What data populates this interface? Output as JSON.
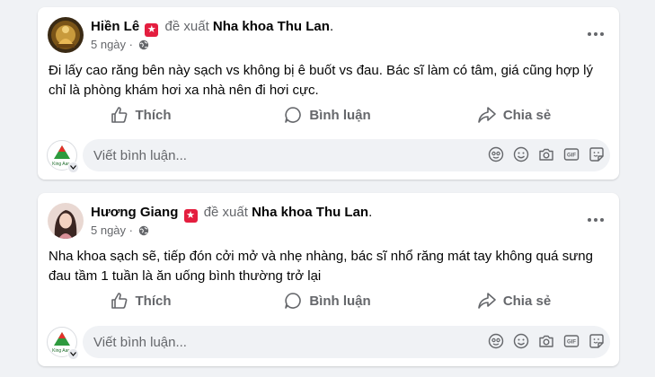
{
  "posts": [
    {
      "author": "Hiền Lê",
      "recommend_text": "đề xuất",
      "page_name": "Nha khoa Thu Lan",
      "after_page": ".",
      "time": "5 ngày",
      "separator": "·",
      "text": "Đi lấy cao răng bên này sạch vs không bị ê buốt vs đau. Bác sĩ làm có tâm, giá cũng hợp lý chỉ là phòng khám hơi xa nhà nên đi hơi cực.",
      "actions": {
        "like": "Thích",
        "comment": "Bình luận",
        "share": "Chia sẻ"
      },
      "comment_placeholder": "Viết bình luận...",
      "commenter_logo_text": "King Aaro"
    },
    {
      "author": "Hương Giang",
      "recommend_text": "đề xuất",
      "page_name": "Nha khoa Thu Lan",
      "after_page": ".",
      "time": "5 ngày",
      "separator": "·",
      "text": "Nha khoa sạch sẽ, tiếp đón cởi mở và nhẹ nhàng, bác sĩ nhổ răng mát tay không quá sưng đau tầm 1 tuần là ăn uống bình thường trở lại",
      "actions": {
        "like": "Thích",
        "comment": "Bình luận",
        "share": "Chia sẻ"
      },
      "comment_placeholder": "Viết bình luận...",
      "commenter_logo_text": "King Aaro"
    }
  ],
  "icons": {
    "recommend": "recommend-badge-icon",
    "privacy": "globe-icon",
    "more": "more-options-icon",
    "like": "thumbs-up-icon",
    "comment": "comment-bubble-icon",
    "share": "share-arrow-icon",
    "avatar_sticker": "avatar-sticker-icon",
    "emoji": "emoji-icon",
    "camera": "camera-icon",
    "gif": "gif-icon",
    "sticker": "sticker-icon"
  },
  "colors": {
    "background": "#f0f2f5",
    "card": "#ffffff",
    "secondary_text": "#65676b",
    "recommend_badge": "#e41e3f"
  }
}
